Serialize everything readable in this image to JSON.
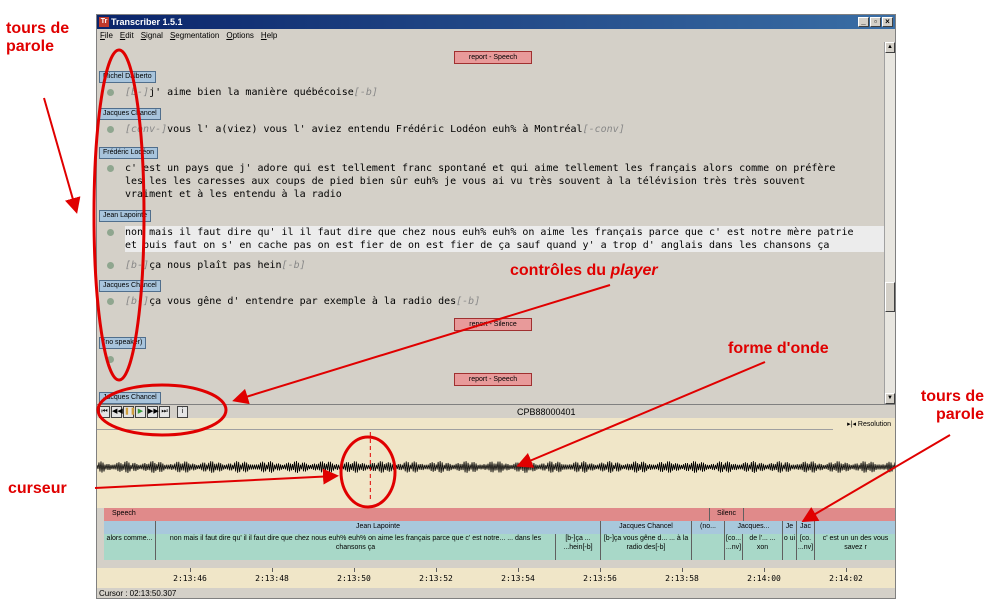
{
  "window": {
    "title": "Transcriber 1.5.1",
    "menu": [
      "File",
      "Edit",
      "Signal",
      "Segmentation",
      "Options",
      "Help"
    ]
  },
  "transcript": {
    "separators": [
      "report - Speech",
      "report - Silence",
      "report - Speech"
    ],
    "turns": [
      {
        "speaker": "Michel Dalberto",
        "lines": [
          "[b-]j' aime bien la manière québécoise[-b]"
        ]
      },
      {
        "speaker": "Jacques Chancel",
        "lines": [
          "[conv-]vous l' a(viez) vous l' aviez entendu Frédéric Lodéon euh% à Montréal[-conv]"
        ]
      },
      {
        "speaker": "Frédéric Lodéon",
        "lines": [
          "c' est un pays que j' adore qui est tellement franc spontané et qui aime tellement les français alors comme on préfère",
          "les les les caresses aux coups de pied bien sûr euh% je vous ai vu très souvent à la télévision très très souvent",
          "vraiment et à les entendu à la radio"
        ]
      },
      {
        "speaker": "Jean Lapointe",
        "lines": [
          "non mais il faut dire qu' il il faut dire que chez nous euh% euh% on aime les français parce que c' est notre mère patrie",
          "et puis faut on s' en cache pas on est fier de on est fier de ça sauf quand y' a trop d' anglais dans les chansons ça",
          "[b-]ça nous plaît pas hein[-b]"
        ]
      },
      {
        "speaker": "Jacques Chancel",
        "lines": [
          "[b-]ça vous gêne d' entendre par exemple à la radio des[-b]"
        ]
      },
      {
        "speaker": "(no speaker)",
        "lines": []
      },
      {
        "speaker": "Jacques Chancel",
        "lines": []
      }
    ]
  },
  "player": {
    "controls": [
      "rewind-fast",
      "rewind",
      "pause",
      "play",
      "forward",
      "forward-fast",
      "info"
    ],
    "filename": "CPB88000401",
    "resolution_label": "Resolution"
  },
  "segmentation": {
    "row1": [
      {
        "label": "Speech"
      },
      {
        "label": "Silenc"
      }
    ],
    "row2": [
      {
        "label": ""
      },
      {
        "label": "Jean Lapointe"
      },
      {
        "label": "Jacques Chancel"
      },
      {
        "label": "(no..."
      },
      {
        "label": "Jacques..."
      },
      {
        "label": "Je"
      },
      {
        "label": "Jac"
      },
      {
        "label": ""
      }
    ],
    "row3": [
      {
        "label": "alors comme..."
      },
      {
        "label": "non mais il faut dire qu' il il faut dire que chez nous euh% euh% on aime les français parce que c' est notre... ... dans les chansons ça"
      },
      {
        "label": "[b-]ça ... ...hein[-b]"
      },
      {
        "label": "[b-]ça vous gêne d... ... à la radio des[-b]"
      },
      {
        "label": ""
      },
      {
        "label": "[co... ...nv]"
      },
      {
        "label": "de l'... ... xon"
      },
      {
        "label": "o ui"
      },
      {
        "label": "[co. ...nv]"
      },
      {
        "label": "c' est un un des vous savez r"
      }
    ],
    "times": [
      "2:13:46",
      "2:13:48",
      "2:13:50",
      "2:13:52",
      "2:13:54",
      "2:13:56",
      "2:13:58",
      "2:14:00",
      "2:14:02"
    ],
    "cursor": "Cursor : 02:13:50.307"
  },
  "annotations": {
    "tours_left": "tours de parole",
    "controles": "contrôles du",
    "controles_em": "player",
    "forme": "forme d'onde",
    "tours_right": "tours de parole",
    "curseur": "curseur"
  },
  "colors": {
    "annotation": "#e00000",
    "speech": "#e08a8a",
    "speaker": "#a8c8dc",
    "text": "#a8d8c8",
    "wave_bg": "#f0e6c8"
  }
}
